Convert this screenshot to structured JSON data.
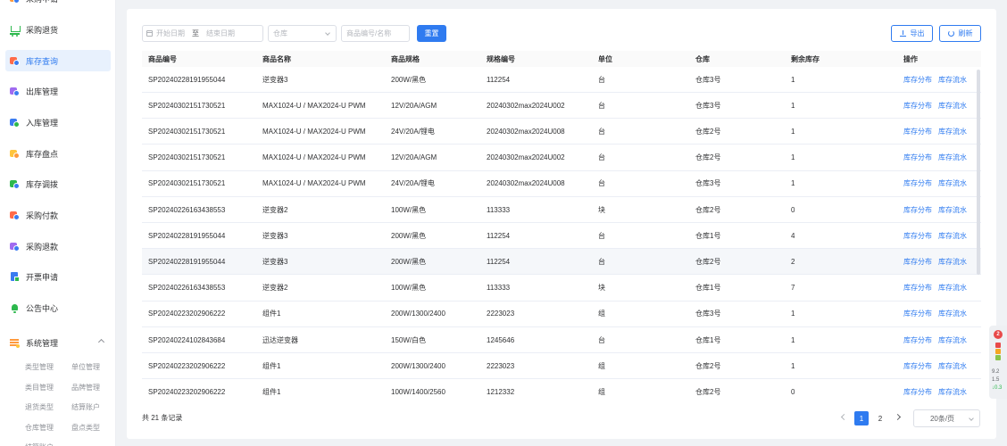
{
  "sidebar": {
    "items": [
      {
        "label": "采购申请"
      },
      {
        "label": "采购退货"
      },
      {
        "label": "库存查询"
      },
      {
        "label": "出库管理"
      },
      {
        "label": "入库管理"
      },
      {
        "label": "库存盘点"
      },
      {
        "label": "库存调拨"
      },
      {
        "label": "采购付款"
      },
      {
        "label": "采购退款"
      },
      {
        "label": "开票申请"
      },
      {
        "label": "公告中心"
      },
      {
        "label": "系统管理"
      }
    ],
    "active_index": 2,
    "submenu": [
      "类型管理",
      "单位管理",
      "类目管理",
      "品牌管理",
      "退货类型",
      "结算账户",
      "仓库管理",
      "盘点类型",
      "结算账户"
    ]
  },
  "filters": {
    "start_date_placeholder": "开始日期",
    "range_separator": "至",
    "end_date_placeholder": "结束日期",
    "warehouse_placeholder": "仓库",
    "keyword_placeholder": "商品编号/名称",
    "reset_label": "重置",
    "export_label": "导出",
    "refresh_label": "刷新"
  },
  "table": {
    "headers": [
      "商品编号",
      "商品名称",
      "商品规格",
      "规格编号",
      "单位",
      "仓库",
      "剩余库存",
      "操作"
    ],
    "action_distribution": "库存分布",
    "action_flow": "库存流水",
    "rows": [
      [
        "SP20240228191955044",
        "逆变器3",
        "200W/黑色",
        "112254",
        "台",
        "仓库3号",
        "1"
      ],
      [
        "SP20240302151730521",
        "MAX1024-U / MAX2024-U PWM",
        "12V/20A/AGM",
        "20240302max2024U002",
        "台",
        "仓库3号",
        "1"
      ],
      [
        "SP20240302151730521",
        "MAX1024-U / MAX2024-U PWM",
        "24V/20A/锂电",
        "20240302max2024U008",
        "台",
        "仓库2号",
        "1"
      ],
      [
        "SP20240302151730521",
        "MAX1024-U / MAX2024-U PWM",
        "12V/20A/AGM",
        "20240302max2024U002",
        "台",
        "仓库2号",
        "1"
      ],
      [
        "SP20240302151730521",
        "MAX1024-U / MAX2024-U PWM",
        "24V/20A/锂电",
        "20240302max2024U008",
        "台",
        "仓库3号",
        "1"
      ],
      [
        "SP20240226163438553",
        "逆变器2",
        "100W/黑色",
        "113333",
        "块",
        "仓库2号",
        "0"
      ],
      [
        "SP20240228191955044",
        "逆变器3",
        "200W/黑色",
        "112254",
        "台",
        "仓库1号",
        "4"
      ],
      [
        "SP20240228191955044",
        "逆变器3",
        "200W/黑色",
        "112254",
        "台",
        "仓库2号",
        "2"
      ],
      [
        "SP20240226163438553",
        "逆变器2",
        "100W/黑色",
        "113333",
        "块",
        "仓库1号",
        "7"
      ],
      [
        "SP20240223202906222",
        "组件1",
        "200W/1300/2400",
        "2223023",
        "组",
        "仓库3号",
        "1"
      ],
      [
        "SP20240224102843684",
        "迅达逆变器",
        "150W/白色",
        "1245646",
        "台",
        "仓库1号",
        "1"
      ],
      [
        "SP20240223202906222",
        "组件1",
        "200W/1300/2400",
        "2223023",
        "组",
        "仓库2号",
        "1"
      ],
      [
        "SP20240223202906222",
        "组件1",
        "100W/1400/2560",
        "1212332",
        "组",
        "仓库2号",
        "0"
      ]
    ],
    "highlighted_row_index": 7
  },
  "footer": {
    "total_text": "共 21 条记录",
    "pages": [
      "1",
      "2"
    ],
    "current_page": "1",
    "page_size": "20条/页"
  },
  "float_widget": {
    "badge": "2",
    "line1": "9.2",
    "line2": "1.5",
    "line3": "↓0.3"
  },
  "colors": {
    "accent": "#2f7bf0",
    "menu_green": "#2db84d",
    "menu_orange": "#ff9a3d",
    "badge_red": "#e84a4a"
  }
}
